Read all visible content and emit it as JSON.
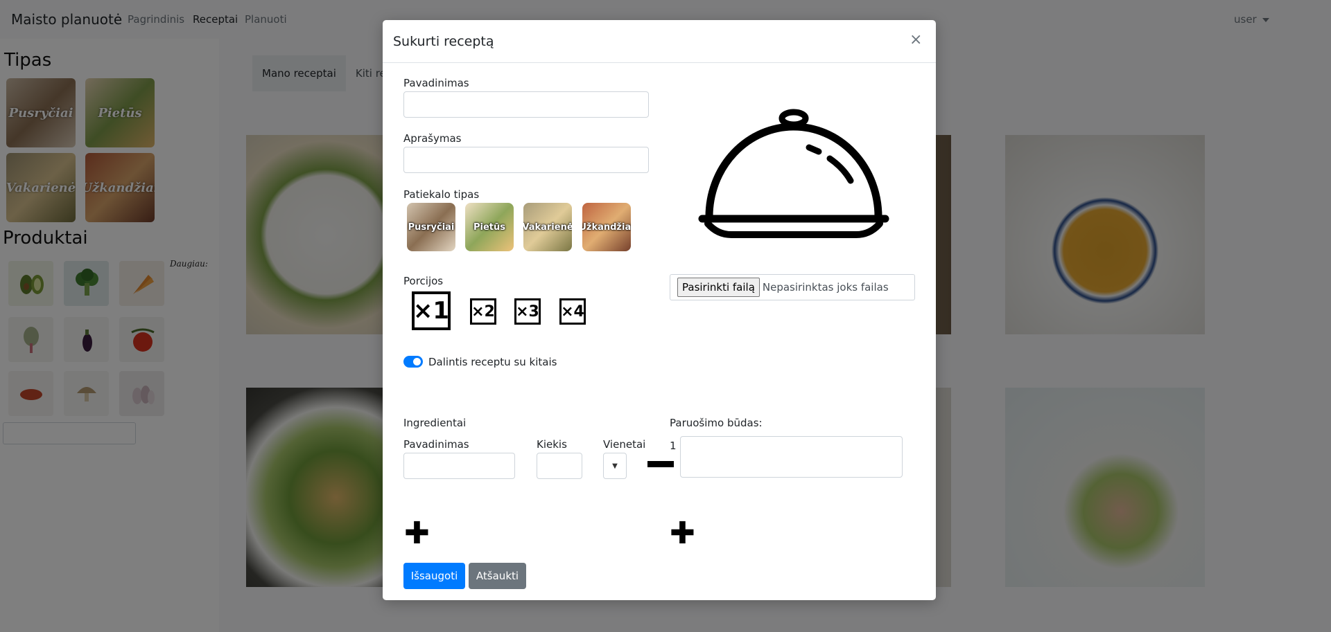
{
  "navbar": {
    "brand": "Maisto planuotė",
    "links": [
      "Pagrindinis",
      "Receptai",
      "Planuoti"
    ],
    "active_link": "Receptai",
    "user": "user"
  },
  "sidebar": {
    "type_heading": "Tipas",
    "types": [
      "Pusryčiai",
      "Pietūs",
      "Vakarienė",
      "Užkandžiai"
    ],
    "products_heading": "Produktai",
    "more_link": "Daugiau:"
  },
  "main": {
    "tabs": [
      "Mano receptai",
      "Kiti rec"
    ]
  },
  "modal": {
    "title": "Sukurti receptą",
    "close_symbol": "×",
    "name_label": "Pavadinimas",
    "description_label": "Aprašymas",
    "dish_type_label": "Patiekalo tipas",
    "dish_types": [
      "Pusryčiai",
      "Pietūs",
      "Vakarienė",
      "Užkandžiai"
    ],
    "portions_label": "Porcijos",
    "portions": [
      "×1",
      "×2",
      "×3",
      "×4"
    ],
    "selected_portion": "×1",
    "file_button": "Pasirinkti failą",
    "file_status": "Nepasirinktas joks failas",
    "share_label": "Dalintis receptu su kitais",
    "share_enabled": true,
    "ingredients_label": "Ingredientai",
    "ingredient_name_label": "Pavadinimas",
    "ingredient_qty_label": "Kiekis",
    "ingredient_unit_label": "Vienetai",
    "steps_label": "Paruošimo būdas:",
    "step_number": "1",
    "save_button": "Išsaugoti",
    "cancel_button": "Atšaukti"
  },
  "colors": {
    "primary": "#007bff",
    "secondary": "#6c757d",
    "backdrop": "rgba(0,0,0,0.5)"
  }
}
